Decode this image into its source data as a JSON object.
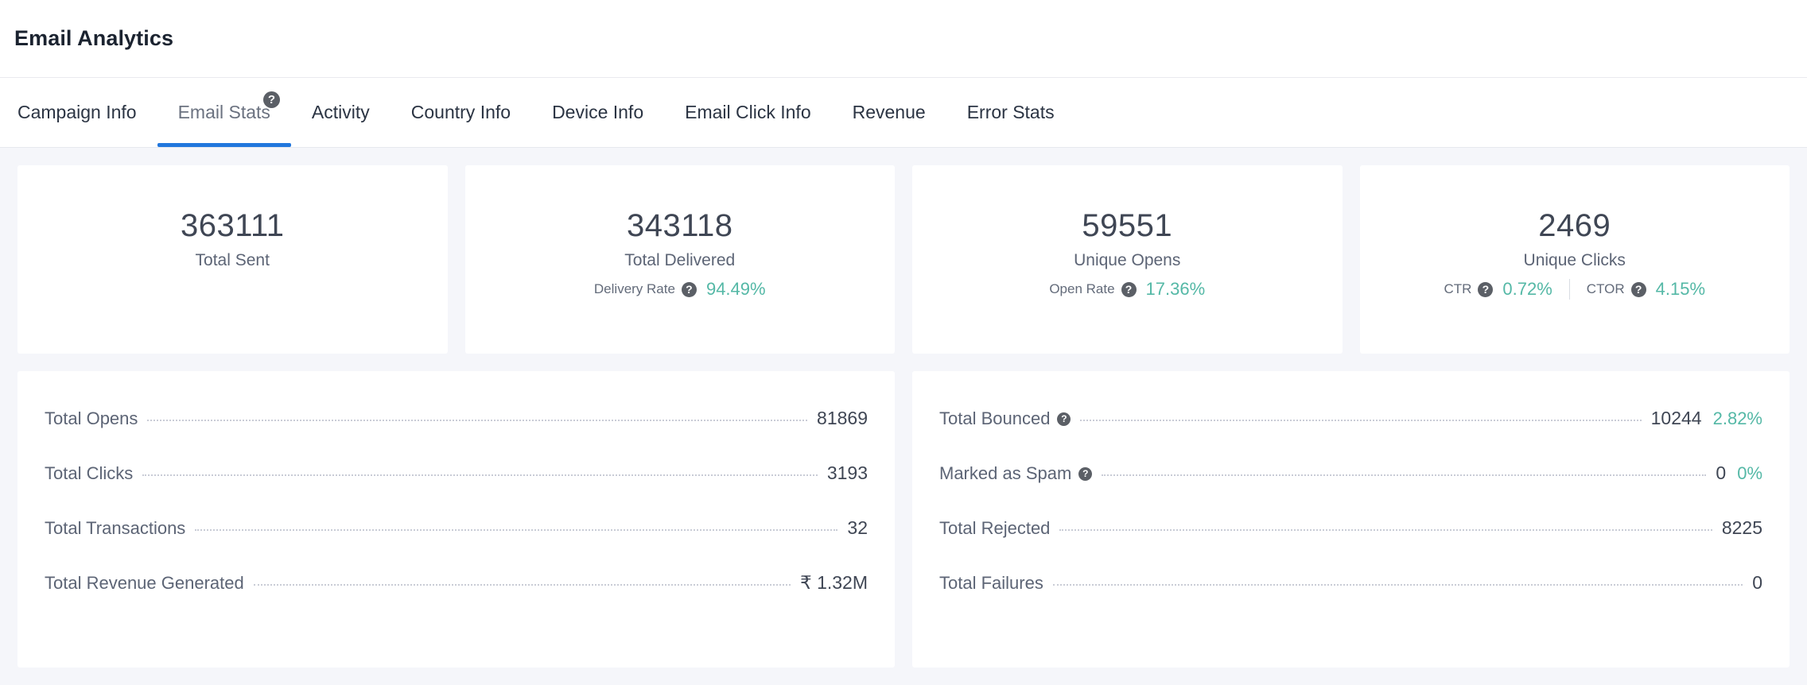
{
  "header": {
    "title": "Email Analytics"
  },
  "colors": {
    "accent_teal": "#54b8a6",
    "tab_active_underline": "#2277dd",
    "page_background": "#f5f6fa",
    "card_background": "#ffffff",
    "text_primary": "#3f4654",
    "text_secondary": "#5c6475"
  },
  "tabs": [
    {
      "label": "Campaign Info",
      "active": false,
      "has_help": false
    },
    {
      "label": "Email Stats",
      "active": true,
      "has_help": true,
      "help_icon": "help-circle-icon"
    },
    {
      "label": "Activity",
      "active": false,
      "has_help": false
    },
    {
      "label": "Country Info",
      "active": false,
      "has_help": false
    },
    {
      "label": "Device Info",
      "active": false,
      "has_help": false
    },
    {
      "label": "Email Click Info",
      "active": false,
      "has_help": false
    },
    {
      "label": "Revenue",
      "active": false,
      "has_help": false
    },
    {
      "label": "Error Stats",
      "active": false,
      "has_help": false
    }
  ],
  "stat_cards": [
    {
      "value": "363111",
      "label": "Total Sent",
      "sub": []
    },
    {
      "value": "343118",
      "label": "Total Delivered",
      "sub": [
        {
          "name": "Delivery Rate",
          "help_icon": "help-circle-icon",
          "pct": "94.49%"
        }
      ]
    },
    {
      "value": "59551",
      "label": "Unique Opens",
      "sub": [
        {
          "name": "Open Rate",
          "help_icon": "help-circle-icon",
          "pct": "17.36%"
        }
      ]
    },
    {
      "value": "2469",
      "label": "Unique Clicks",
      "sub": [
        {
          "name": "CTR",
          "help_icon": "help-circle-icon",
          "pct": "0.72%"
        },
        {
          "name": "CTOR",
          "help_icon": "help-circle-icon",
          "pct": "4.15%"
        }
      ]
    }
  ],
  "list_left": [
    {
      "label": "Total Opens",
      "help_icon": null,
      "value": "81869",
      "pct": null
    },
    {
      "label": "Total Clicks",
      "help_icon": null,
      "value": "3193",
      "pct": null
    },
    {
      "label": "Total Transactions",
      "help_icon": null,
      "value": "32",
      "pct": null
    },
    {
      "label": "Total Revenue Generated",
      "help_icon": null,
      "value": "₹ 1.32M",
      "pct": null
    }
  ],
  "list_right": [
    {
      "label": "Total Bounced",
      "help_icon": "help-circle-icon",
      "value": "10244",
      "pct": "2.82%"
    },
    {
      "label": "Marked as Spam",
      "help_icon": "help-circle-icon",
      "value": "0",
      "pct": "0%"
    },
    {
      "label": "Total Rejected",
      "help_icon": null,
      "value": "8225",
      "pct": null
    },
    {
      "label": "Total Failures",
      "help_icon": null,
      "value": "0",
      "pct": null
    }
  ]
}
